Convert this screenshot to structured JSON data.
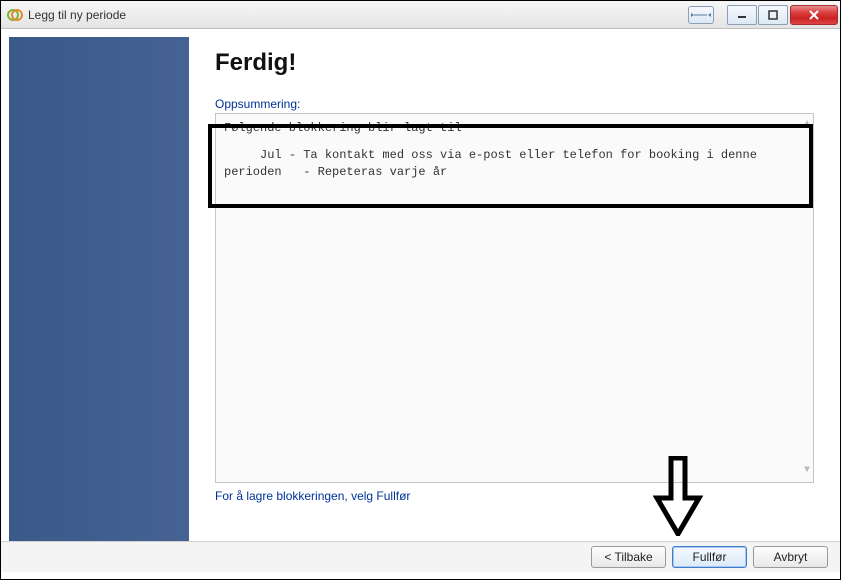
{
  "titlebar": {
    "title": "Legg til ny periode"
  },
  "main": {
    "heading": "Ferdig!",
    "summary_label": "Oppsummering:",
    "summary_line1": "Følgende blokkering blir lagt til",
    "summary_line2": "     Jul - Ta kontakt med oss via e-post eller telefon for booking i denne perioden   - Repeteras varje år",
    "instruction": "For å lagre blokkeringen, velg Fullfør"
  },
  "footer": {
    "back": "< Tilbake",
    "finish": "Fullfør",
    "cancel": "Avbryt"
  }
}
